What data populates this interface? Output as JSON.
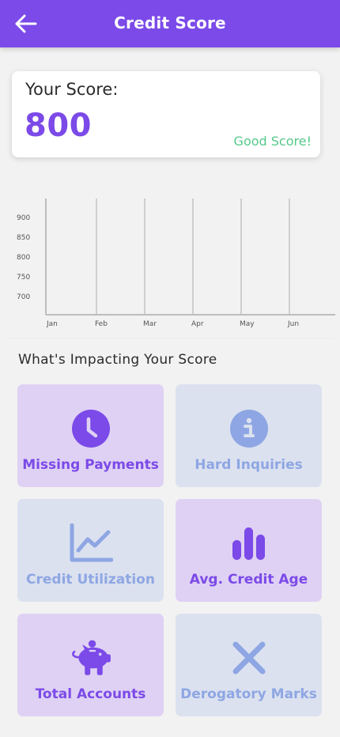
{
  "header": {
    "title": "Credit Score",
    "back_icon": "arrow-left-icon"
  },
  "score_card": {
    "label": "Your Score:",
    "value": "800",
    "status": "Good Score!"
  },
  "colors": {
    "primary": "#7b4ae8",
    "good": "#55c98a",
    "tile_purple": "#dfd1f4",
    "tile_blue": "#dbe1ef",
    "icon_blue": "#8ea6e3"
  },
  "chart_data": {
    "type": "line",
    "categories": [
      "Jan",
      "Feb",
      "Mar",
      "Apr",
      "May",
      "Jun"
    ],
    "y_ticks": [
      "900",
      "850",
      "800",
      "750",
      "700"
    ],
    "ylim": [
      700,
      900
    ],
    "series": [],
    "grid": "vertical"
  },
  "impact": {
    "title": "What's Impacting Your Score",
    "tiles": [
      {
        "label": "Missing Payments",
        "icon": "clock-icon",
        "style": "purple"
      },
      {
        "label": "Hard Inquiries",
        "icon": "info-icon",
        "style": "blue"
      },
      {
        "label": "Credit Utilization",
        "icon": "line-chart-icon",
        "style": "blue"
      },
      {
        "label": "Avg. Credit Age",
        "icon": "bar-chart-icon",
        "style": "purple"
      },
      {
        "label": "Total Accounts",
        "icon": "piggy-bank-icon",
        "style": "purple"
      },
      {
        "label": "Derogatory Marks",
        "icon": "close-x-icon",
        "style": "blue"
      }
    ]
  }
}
